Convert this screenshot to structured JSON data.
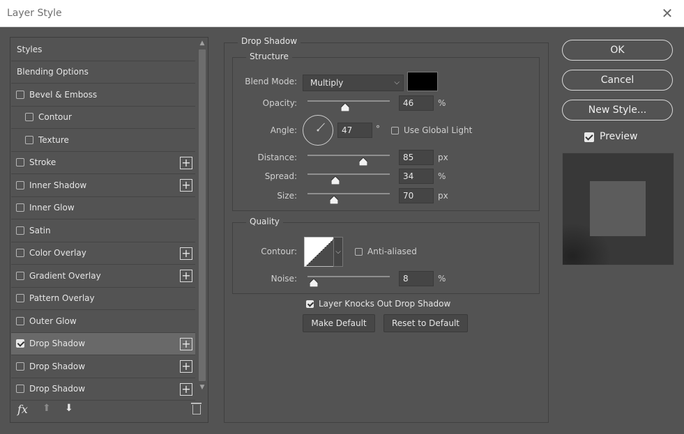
{
  "window": {
    "title": "Layer Style"
  },
  "styles_list": {
    "items": [
      {
        "label": "Styles",
        "type": "header"
      },
      {
        "label": "Blending Options",
        "type": "header"
      },
      {
        "label": "Bevel & Emboss",
        "checked": false,
        "plus": false
      },
      {
        "label": "Contour",
        "checked": false,
        "plus": false,
        "indent": true
      },
      {
        "label": "Texture",
        "checked": false,
        "plus": false,
        "indent": true
      },
      {
        "label": "Stroke",
        "checked": false,
        "plus": true
      },
      {
        "label": "Inner Shadow",
        "checked": false,
        "plus": true
      },
      {
        "label": "Inner Glow",
        "checked": false,
        "plus": false
      },
      {
        "label": "Satin",
        "checked": false,
        "plus": false
      },
      {
        "label": "Color Overlay",
        "checked": false,
        "plus": true
      },
      {
        "label": "Gradient Overlay",
        "checked": false,
        "plus": true
      },
      {
        "label": "Pattern Overlay",
        "checked": false,
        "plus": false
      },
      {
        "label": "Outer Glow",
        "checked": false,
        "plus": false
      },
      {
        "label": "Drop Shadow",
        "checked": true,
        "plus": true,
        "selected": true
      },
      {
        "label": "Drop Shadow",
        "checked": false,
        "plus": true
      },
      {
        "label": "Drop Shadow",
        "checked": false,
        "plus": true
      }
    ],
    "footer": {
      "fx": "fx"
    }
  },
  "drop_shadow": {
    "section_title": "Drop Shadow",
    "structure": {
      "title": "Structure",
      "blend_mode": {
        "label": "Blend Mode:",
        "value": "Multiply"
      },
      "shadow_color": "#000000",
      "opacity": {
        "label": "Opacity:",
        "value": "46",
        "unit": "%",
        "level": 0.46
      },
      "angle": {
        "label": "Angle:",
        "value": "47",
        "unit": "°"
      },
      "use_global_light": {
        "label": "Use Global Light",
        "checked": false
      },
      "distance": {
        "label": "Distance:",
        "value": "85",
        "unit": "px",
        "level": 0.68
      },
      "spread": {
        "label": "Spread:",
        "value": "34",
        "unit": "%",
        "level": 0.34
      },
      "size": {
        "label": "Size:",
        "value": "70",
        "unit": "px",
        "level": 0.32
      }
    },
    "quality": {
      "title": "Quality",
      "contour": {
        "label": "Contour:"
      },
      "anti_aliased": {
        "label": "Anti-aliased",
        "checked": false
      },
      "noise": {
        "label": "Noise:",
        "value": "8",
        "unit": "%",
        "level": 0.08
      }
    },
    "layer_knocks_out": {
      "label": "Layer Knocks Out Drop Shadow",
      "checked": true
    },
    "make_default": "Make Default",
    "reset_to_default": "Reset to Default"
  },
  "actions": {
    "ok": "OK",
    "cancel": "Cancel",
    "new_style": "New Style...",
    "preview": {
      "label": "Preview",
      "checked": true
    }
  }
}
